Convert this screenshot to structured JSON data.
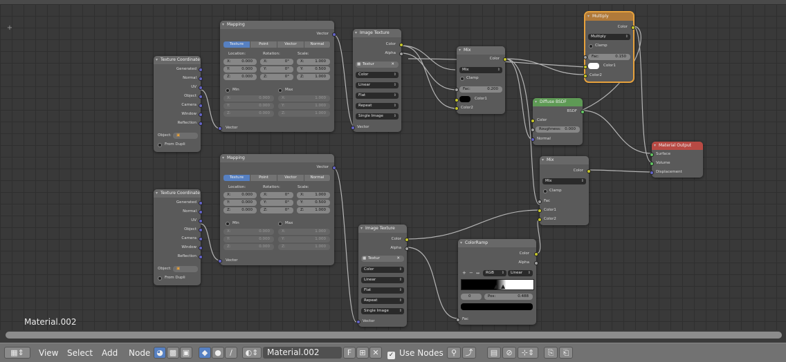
{
  "material_label": "Material.002",
  "header": {
    "menus": [
      "View",
      "Select",
      "Add",
      "Node"
    ],
    "material_name": "Material.002",
    "fake_user": "F",
    "use_nodes_label": "Use Nodes",
    "use_nodes_checked": true
  },
  "icons": {
    "editor_type": "node-editor-icon",
    "shader": "shader-tree-icon",
    "object": "object-icon",
    "pin": "pin-icon",
    "snap": "snap-icon"
  },
  "colors": {
    "bg": "#393939",
    "selected_outline": "#e8a23c",
    "socket_color": "#c7c729",
    "socket_vector": "#6363c7",
    "socket_shader": "#63c763"
  },
  "tex_coord": {
    "title": "Texture Coordinate",
    "outputs": [
      "Generated",
      "Normal",
      "UV",
      "Object",
      "Camera",
      "Window",
      "Reflection"
    ],
    "object_label": "Object:",
    "from_dupli": "From Dupli"
  },
  "mapping_top": {
    "title": "Mapping",
    "out": "Vector",
    "tabs": [
      "Texture",
      "Point",
      "Vector",
      "Normal"
    ],
    "col_location": "Location:",
    "col_rotation": "Rotation:",
    "col_scale": "Scale:",
    "loc": [
      [
        "X:",
        "0.000"
      ],
      [
        "Y:",
        "0.000"
      ],
      [
        "Z:",
        "0.000"
      ]
    ],
    "rot": [
      [
        "X:",
        "0°"
      ],
      [
        "Y:",
        "0°"
      ],
      [
        "Z:",
        "0°"
      ]
    ],
    "scale": [
      [
        "X:",
        "1.000"
      ],
      [
        "Y:",
        "0.500"
      ],
      [
        "Z:",
        "1.000"
      ]
    ],
    "min": "Min",
    "max": "Max",
    "min_vals": [
      [
        "X:",
        "0.000"
      ],
      [
        "Y:",
        "0.000"
      ],
      [
        "Z:",
        "0.000"
      ]
    ],
    "max_vals": [
      [
        "X:",
        "1.000"
      ],
      [
        "Y:",
        "1.000"
      ],
      [
        "Z:",
        "1.000"
      ]
    ],
    "in": "Vector"
  },
  "mapping_bot": {
    "title": "Mapping",
    "out": "Vector",
    "tabs": [
      "Texture",
      "Point",
      "Vector",
      "Normal"
    ],
    "col_location": "Location:",
    "col_rotation": "Rotation:",
    "col_scale": "Scale:",
    "loc": [
      [
        "X:",
        "0.000"
      ],
      [
        "Y:",
        "0.000"
      ],
      [
        "Z:",
        "0.000"
      ]
    ],
    "rot": [
      [
        "X:",
        "0°"
      ],
      [
        "Y:",
        "0°"
      ],
      [
        "Z:",
        "0°"
      ]
    ],
    "scale": [
      [
        "X:",
        "1.000"
      ],
      [
        "Y:",
        "0.500"
      ],
      [
        "Z:",
        "1.000"
      ]
    ],
    "min": "Min",
    "max": "Max",
    "min_vals": [
      [
        "X:",
        "0.000"
      ],
      [
        "Y:",
        "0.000"
      ],
      [
        "Z:",
        "0.000"
      ]
    ],
    "max_vals": [
      [
        "X:",
        "1.000"
      ],
      [
        "Y:",
        "1.000"
      ],
      [
        "Z:",
        "1.000"
      ]
    ],
    "in": "Vector"
  },
  "img_top": {
    "title": "Image Texture",
    "out_color": "Color",
    "out_alpha": "Alpha",
    "texture": "Textur",
    "opts": [
      "Color",
      "Linear",
      "Flat",
      "Repeat",
      "Single Image"
    ],
    "in": "Vector"
  },
  "img_bot": {
    "title": "Image Texture",
    "out_color": "Color",
    "out_alpha": "Alpha",
    "texture": "Textur",
    "opts": [
      "Color",
      "Linear",
      "Flat",
      "Repeat",
      "Single Image"
    ],
    "in": "Vector"
  },
  "mix_top": {
    "title": "Mix",
    "out": "Color",
    "mode": "Mix",
    "clamp": "Clamp",
    "fac_label": "Fac:",
    "fac_val": "0.200",
    "color1": "Color1",
    "color2": "Color2"
  },
  "multiply": {
    "title": "Multiply",
    "out": "Color",
    "mode": "Multiply",
    "clamp": "Clamp",
    "fac_label": "Fac:",
    "fac_val": "0.150",
    "color1": "Color1",
    "color2": "Color2"
  },
  "diffuse": {
    "title": "Diffuse BSDF",
    "out": "BSDF",
    "color": "Color",
    "rough_label": "Roughness:",
    "rough_val": "0.000",
    "normal": "Normal"
  },
  "output": {
    "title": "Material Output",
    "inputs": [
      "Surface",
      "Volume",
      "Displacement"
    ]
  },
  "mix_bot": {
    "title": "Mix",
    "out": "Color",
    "mode": "Mix",
    "clamp": "Clamp",
    "fac": "Fac",
    "color1": "Color1",
    "color2": "Color2"
  },
  "ramp": {
    "title": "ColorRamp",
    "out_color": "Color",
    "out_alpha": "Alpha",
    "mode": "RGB",
    "interp": "Linear",
    "stop_idx": "0",
    "pos_label": "Pos:",
    "pos_val": "0.488",
    "in": "Fac"
  }
}
